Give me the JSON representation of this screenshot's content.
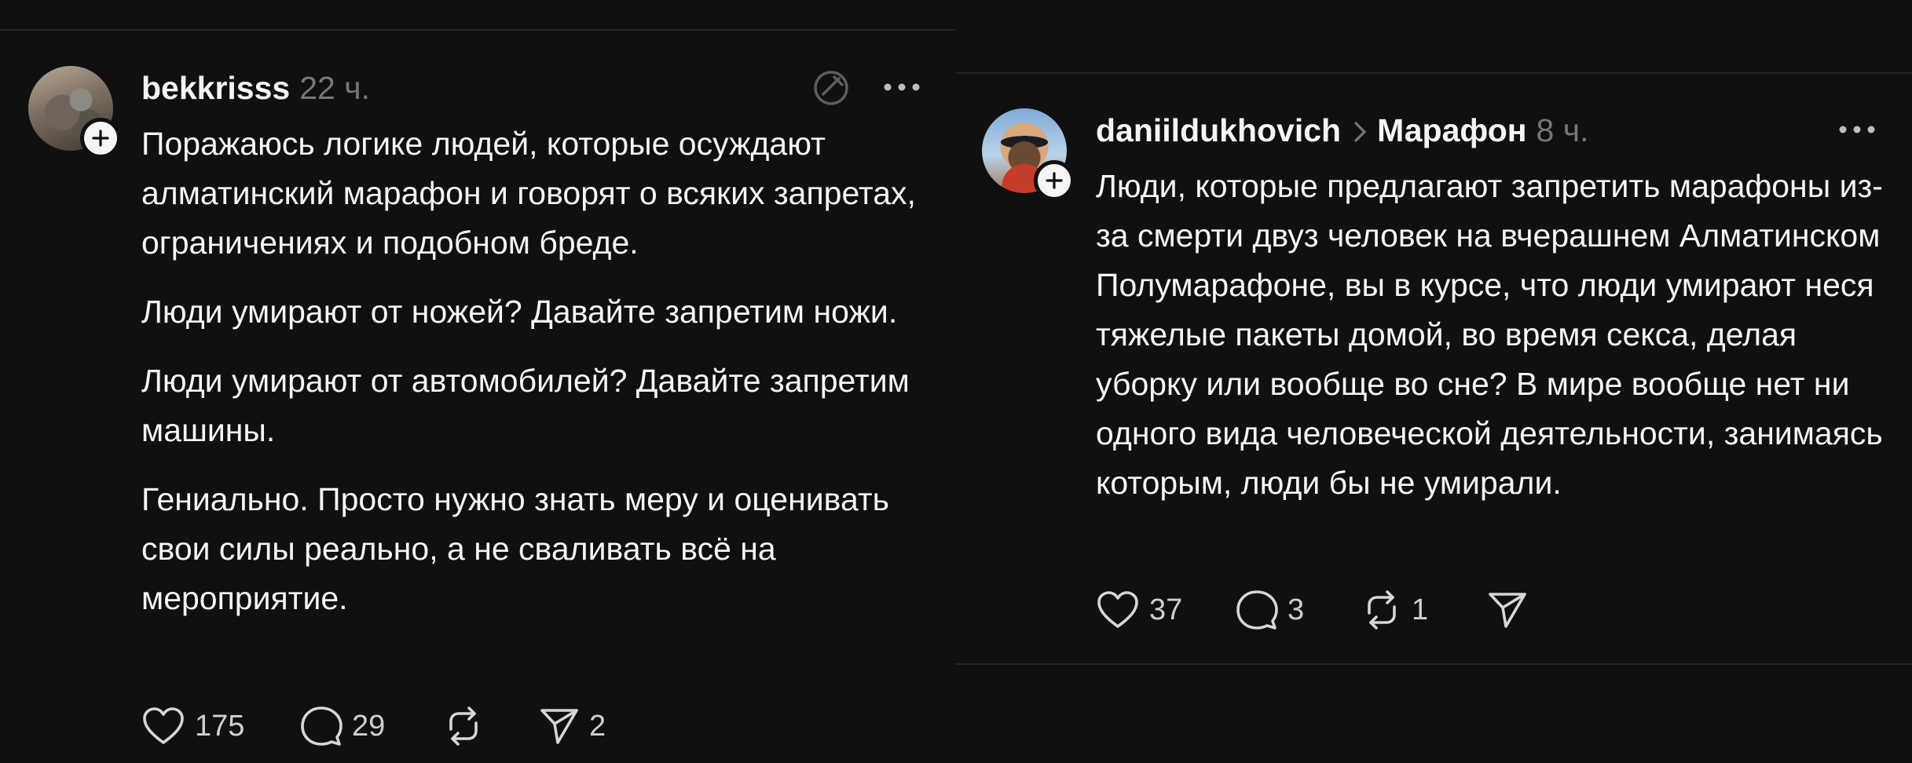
{
  "posts": [
    {
      "username": "bekkrisss",
      "time": "22 ч.",
      "paragraphs": [
        "Поражаюсь логике людей, которые осуждают алматинский марафон и говорят о всяких запретах, ограничениях и подобном бреде.",
        "Люди умирают от ножей? Давайте запретим ножи.",
        "Люди умирают от автомобилей? Давайте запретим машины.",
        "Гениально. Просто нужно знать меру и оценивать свои силы реально, а не сваливать всё на мероприятие."
      ],
      "likes": "175",
      "replies": "29",
      "reposts": "",
      "shares": "2"
    },
    {
      "username": "daniildukhovich",
      "topic": "Марафон",
      "time": "8 ч.",
      "paragraphs": [
        "Люди, которые предлагают запретить марафоны из-за смерти двуз человек на вчерашнем Алматинском Полумарафоне, вы в курсе, что люди умирают неся тяжелые пакеты домой, во время секса, делая уборку или вообще во сне? В мире вообще нет ни одного вида человеческой деятельности, занимаясь которым, люди бы не умирали."
      ],
      "likes": "37",
      "replies": "3",
      "reposts": "1",
      "shares": ""
    }
  ],
  "colors": {
    "background": "#101010",
    "text": "#f3f5f7",
    "muted": "#777777",
    "divider": "#262626"
  },
  "icons": {
    "follow": "plus-icon",
    "edit": "edit-slash-icon",
    "more": "more-dots-icon",
    "like": "heart-icon",
    "reply": "comment-bubble-icon",
    "repost": "repost-arrows-icon",
    "share": "send-paper-plane-icon",
    "topic_separator": "chevron-right-icon"
  }
}
